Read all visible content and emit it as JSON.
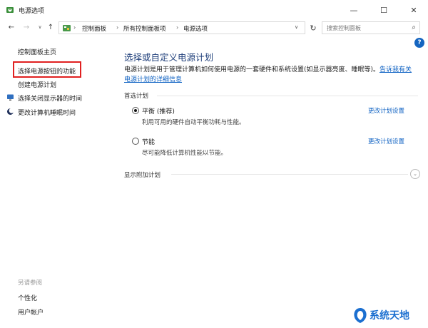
{
  "window": {
    "title": "电源选项",
    "minimize": "—",
    "maximize": "☐",
    "close": "✕"
  },
  "nav": {
    "back": "←",
    "forward": "→",
    "recent": "∨",
    "up": "↑",
    "breadcrumb": [
      "控制面板",
      "所有控制面板项",
      "电源选项"
    ],
    "breadcrumb_sep": "›",
    "address_dropdown": "∨",
    "refresh": "↻",
    "search_placeholder": "搜索控制面板",
    "search_icon": "⌕"
  },
  "sidebar": {
    "home": "控制面板主页",
    "links": [
      "选择电源按钮的功能",
      "创建电源计划",
      "选择关闭显示器的时间",
      "更改计算机睡眠时间"
    ],
    "see_also_label": "另请参阅",
    "see_also": [
      "个性化",
      "用户帐户"
    ],
    "highlight_color": "#e02020"
  },
  "main": {
    "help": "?",
    "title": "选择或自定义电源计划",
    "description": "电源计划是用于管理计算机如何使用电源的一套硬件和系统设置(如显示器亮度、睡眠等)。",
    "description_link": "告诉我有关电源计划的详细信息",
    "preferred_label": "首选计划",
    "plans": [
      {
        "name": "平衡 (推荐)",
        "desc": "利用可用的硬件自动平衡功耗与性能。",
        "link": "更改计划设置",
        "selected": true
      },
      {
        "name": "节能",
        "desc": "尽可能降低计算机性能以节能。",
        "link": "更改计划设置",
        "selected": false
      }
    ],
    "show_more": "显示附加计划",
    "expand_icon": "⌄"
  },
  "watermark": {
    "text": "系统天地"
  },
  "colors": {
    "accent": "#0f62c3",
    "title": "#1e3e7a",
    "help": "#1565c0"
  }
}
